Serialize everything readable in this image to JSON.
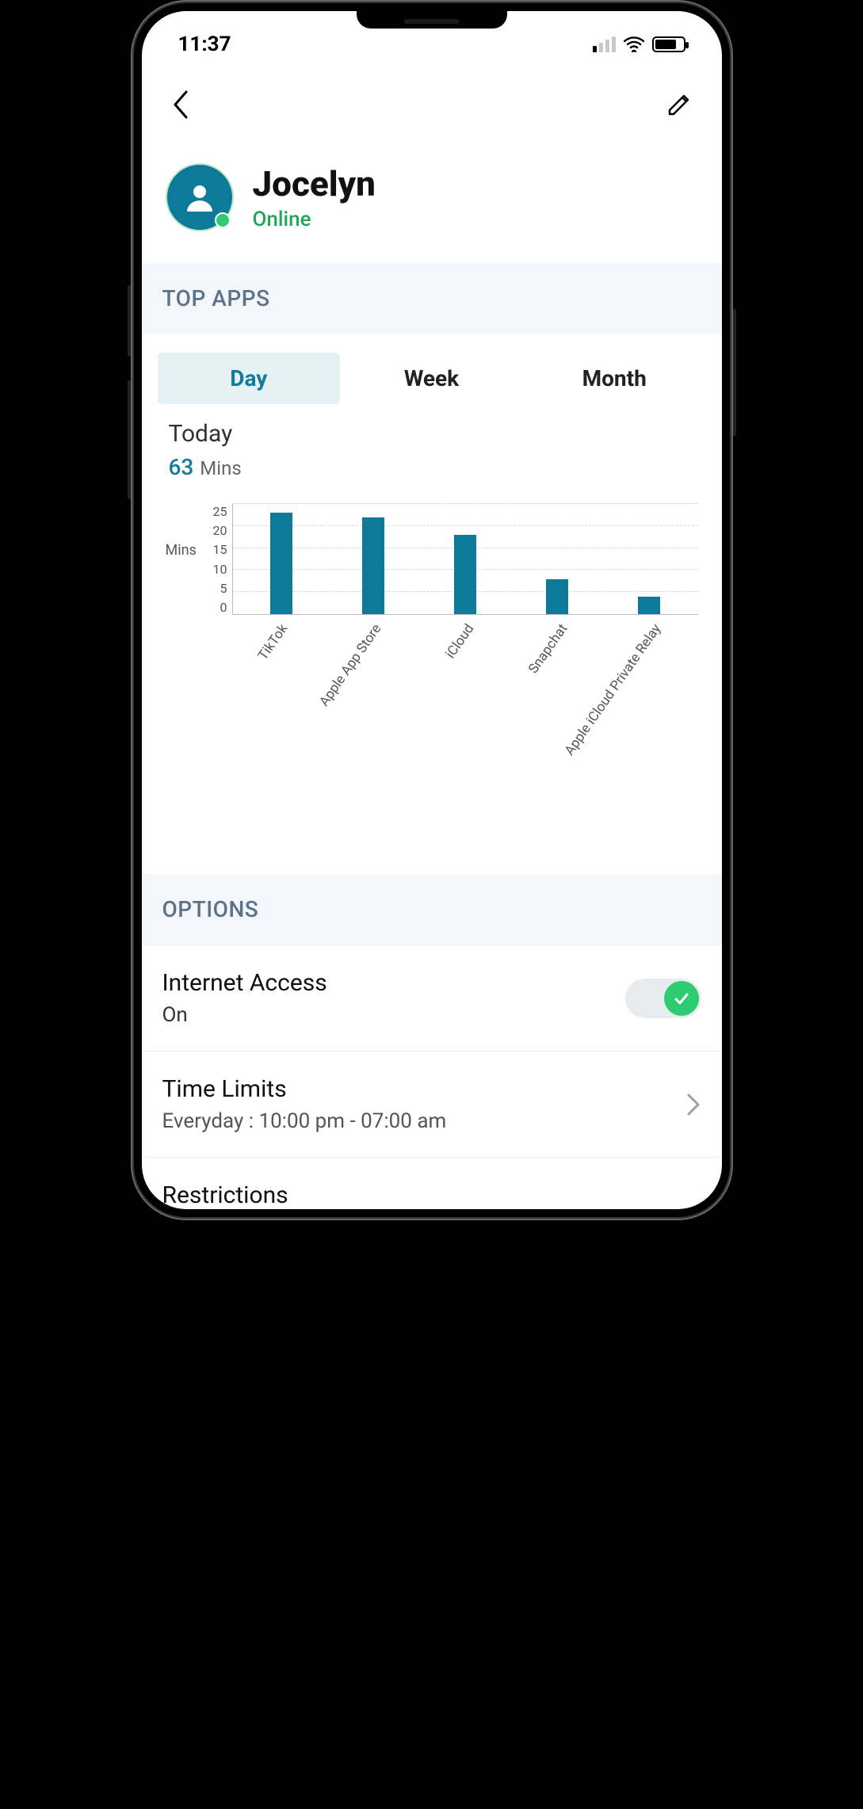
{
  "status_bar": {
    "time": "11:37"
  },
  "header": {
    "back_icon": "chevron-left",
    "edit_icon": "pencil"
  },
  "profile": {
    "name": "Jocelyn",
    "status": "Online"
  },
  "sections": {
    "top_apps": "TOP APPS",
    "options": "OPTIONS"
  },
  "tabs": {
    "day": "Day",
    "week": "Week",
    "month": "Month",
    "active": "day"
  },
  "summary": {
    "label": "Today",
    "value": "63",
    "unit": "Mins"
  },
  "chart_data": {
    "type": "bar",
    "ylabel": "Mins",
    "ylim": [
      0,
      25
    ],
    "yticks": [
      0,
      5,
      10,
      15,
      20,
      25
    ],
    "categories": [
      "TikTok",
      "Apple App Store",
      "iCloud",
      "Snapchat",
      "Apple iCloud Private Relay"
    ],
    "values": [
      23,
      22,
      18,
      8,
      4
    ]
  },
  "options": {
    "internet_access": {
      "title": "Internet Access",
      "value": "On",
      "toggle_on": true
    },
    "time_limits": {
      "title": "Time Limits",
      "value": "Everyday : 10:00 pm - 07:00 am"
    },
    "restrictions": {
      "title": "Restrictions"
    }
  }
}
